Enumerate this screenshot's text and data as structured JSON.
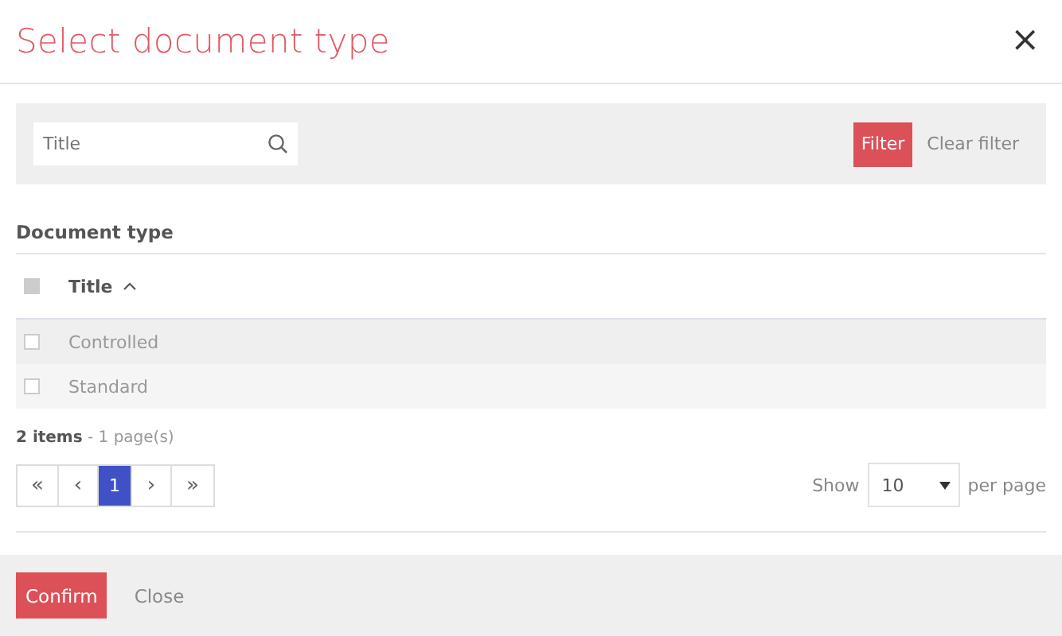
{
  "dialog": {
    "title": "Select document type",
    "close": "×"
  },
  "filter": {
    "placeholder": "Title",
    "filter_button": "Filter",
    "clear_button": "Clear filter"
  },
  "section": {
    "title": "Document type"
  },
  "table": {
    "select_all": {
      "disabled": true
    },
    "columns": [
      {
        "label": "Title",
        "sorted": true
      }
    ],
    "rows": [
      {
        "title": "Controlled",
        "checked": false
      },
      {
        "title": "Standard",
        "checked": false
      }
    ]
  },
  "summary": "**2 items** - 1 page(s)",
  "pagination": {
    "pages": [
      {
        "label": "«",
        "kind": "nav",
        "selected": false
      },
      {
        "label": "‹",
        "kind": "nav",
        "selected": false
      },
      {
        "label": "1",
        "kind": "page",
        "selected": true
      },
      {
        "label": "›",
        "kind": "nav",
        "selected": false
      },
      {
        "label": "»",
        "kind": "nav",
        "selected": false
      }
    ],
    "show_label": "Show",
    "page_size": "10",
    "per_page_label": "per page"
  },
  "footer": {
    "confirm": "Confirm",
    "close": "Close"
  }
}
